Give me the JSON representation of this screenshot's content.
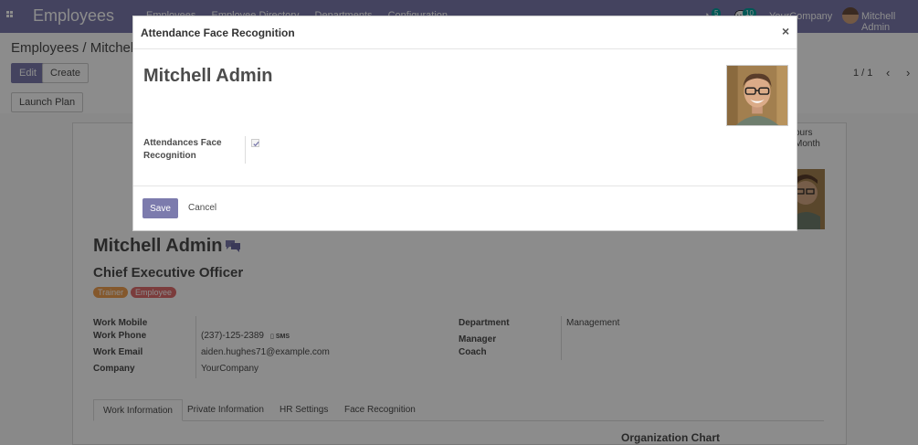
{
  "navbar": {
    "app_name": "Employees",
    "menu": [
      "Employees",
      "Employee Directory",
      "Departments",
      "Configuration"
    ],
    "activity_count": "5",
    "message_count": "10",
    "company": "YourCompany",
    "user": "Mitchell Admin"
  },
  "control_panel": {
    "breadcrumb": "Employees / Mitchell Admin",
    "edit_label": "Edit",
    "create_label": "Create",
    "launch_plan_label": "Launch Plan",
    "pager": "1 / 1",
    "prev_icon": "‹",
    "next_icon": "›"
  },
  "form": {
    "stat_button": "ours\nMonth",
    "name": "Mitchell Admin",
    "job_title": "Chief Executive Officer",
    "tags": [
      "Trainer",
      "Employee"
    ],
    "fields_left": [
      {
        "label": "Work Mobile",
        "value": ""
      },
      {
        "label": "Work Phone",
        "value": "(237)-125-2389"
      },
      {
        "label": "Work Email",
        "value": "aiden.hughes71@example.com"
      },
      {
        "label": "Company",
        "value": "YourCompany"
      }
    ],
    "sms_label": "SMS",
    "fields_right": [
      {
        "label": "Department",
        "value": "Management"
      },
      {
        "label": "Manager",
        "value": ""
      },
      {
        "label": "Coach",
        "value": ""
      }
    ],
    "tabs": [
      "Work Information",
      "Private Information",
      "HR Settings",
      "Face Recognition"
    ],
    "org_chart_title": "Organization Chart"
  },
  "modal": {
    "title": "Attendance Face Recognition",
    "close_icon": "×",
    "employee_name": "Mitchell Admin",
    "field_label": "Attendances Face Recognition",
    "field_checked": true,
    "save_label": "Save",
    "cancel_label": "Cancel"
  },
  "colors": {
    "brand": "#7c7bad",
    "tag_trainer": "#f0a050",
    "tag_employee": "#e06e6e",
    "badge": "#00a09d"
  }
}
